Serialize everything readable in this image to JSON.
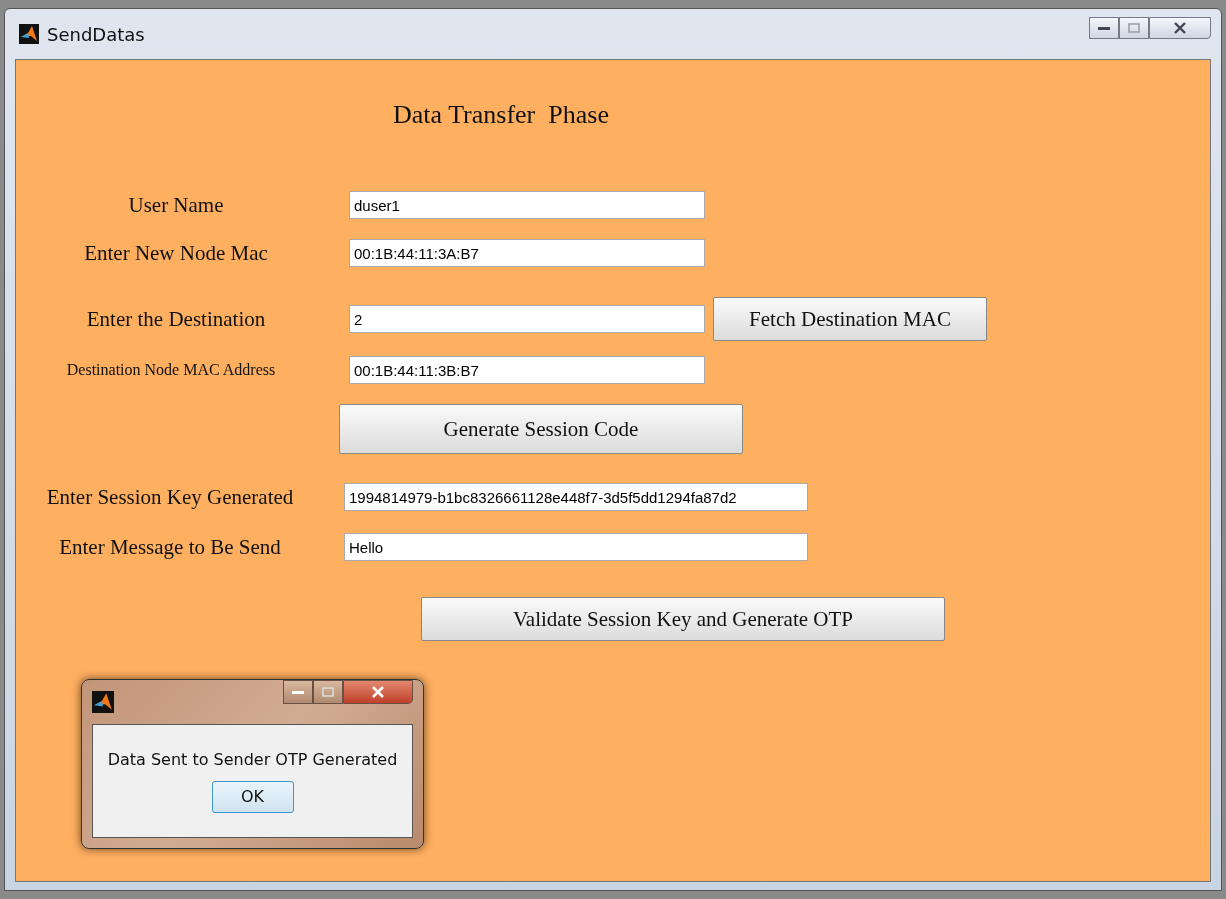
{
  "window": {
    "title": "SendDatas"
  },
  "heading": "Data Transfer  Phase",
  "form": [
    {
      "kind": "field",
      "label": "User Name",
      "value": "duser1"
    },
    {
      "kind": "field",
      "label": "Enter New Node Mac",
      "value": "00:1B:44:11:3A:B7"
    },
    {
      "kind": "field",
      "label": "Enter the Destination",
      "value": "2",
      "button": "Fetch Destination MAC"
    },
    {
      "kind": "field",
      "label": "Destination Node MAC Address",
      "value": "00:1B:44:11:3B:B7"
    },
    {
      "kind": "button",
      "label": "Generate Session Code"
    },
    {
      "kind": "field",
      "label": "Enter Session Key Generated",
      "value": "1994814979-b1bc8326661128e448f7-3d5f5dd1294fa87d2"
    },
    {
      "kind": "field",
      "label": "Enter Message to Be Send",
      "value": "Hello"
    },
    {
      "kind": "button",
      "label": "Validate Session Key and Generate OTP"
    }
  ],
  "dialog": {
    "message": "Data Sent to Sender OTP Generated",
    "button": "OK"
  }
}
